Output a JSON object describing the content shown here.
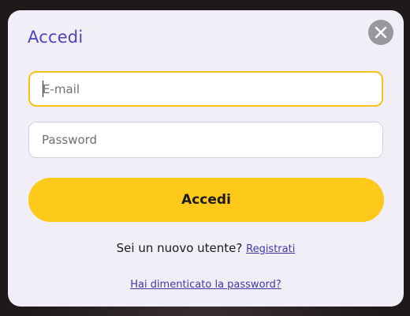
{
  "dialog": {
    "title": "Accedi",
    "close_icon": "close-icon"
  },
  "form": {
    "email": {
      "placeholder": "E-mail",
      "value": ""
    },
    "password": {
      "placeholder": "Password",
      "value": ""
    },
    "submit_label": "Accedi"
  },
  "register": {
    "prompt": "Sei un nuovo utente?",
    "link_label": "Registrati"
  },
  "forgot": {
    "link_label": "Hai dimenticato la password?"
  },
  "colors": {
    "modal_background": "#f1eef8",
    "title": "#4a45b8",
    "accent_yellow": "#fdca1b",
    "focus_border": "#f2c318",
    "link": "#3f3aa8",
    "close_button": "#9a979c"
  }
}
